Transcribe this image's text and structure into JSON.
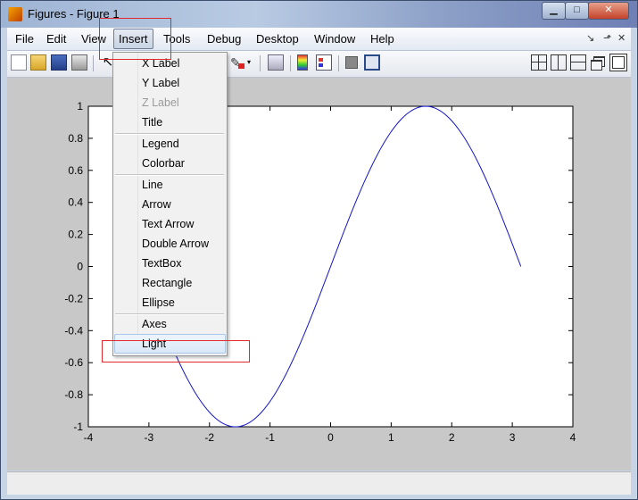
{
  "window": {
    "title": "Figures - Figure 1"
  },
  "window_controls": {
    "minimize": "▁",
    "maximize": "□",
    "close": "✕"
  },
  "menubar": {
    "items": [
      "File",
      "Edit",
      "View",
      "Insert",
      "Tools",
      "Debug",
      "Desktop",
      "Window",
      "Help"
    ],
    "active": "Insert",
    "dock_icons": [
      "↘",
      "⬏",
      "✕"
    ]
  },
  "toolbar": {
    "icons": [
      "new-figure-icon",
      "open-file-icon",
      "save-icon",
      "print-icon",
      "pointer-icon",
      "brush-icon",
      "link-plot-icon",
      "colorbar-icon",
      "legend-icon",
      "hide-plot-tools-icon",
      "show-plot-tools-icon"
    ],
    "layout_icons": [
      "tile-icon",
      "left-right-icon",
      "top-bottom-icon",
      "float-icon",
      "maximize-icon"
    ]
  },
  "insert_menu": {
    "items": [
      {
        "label": "X Label",
        "enabled": true
      },
      {
        "label": "Y Label",
        "enabled": true
      },
      {
        "label": "Z Label",
        "enabled": false
      },
      {
        "label": "Title",
        "enabled": true
      },
      {
        "separator": true
      },
      {
        "label": "Legend",
        "enabled": true
      },
      {
        "label": "Colorbar",
        "enabled": true
      },
      {
        "separator": true
      },
      {
        "label": "Line",
        "enabled": true
      },
      {
        "label": "Arrow",
        "enabled": true
      },
      {
        "label": "Text Arrow",
        "enabled": true
      },
      {
        "label": "Double Arrow",
        "enabled": true
      },
      {
        "label": "TextBox",
        "enabled": true
      },
      {
        "label": "Rectangle",
        "enabled": true
      },
      {
        "label": "Ellipse",
        "enabled": true
      },
      {
        "separator": true
      },
      {
        "label": "Axes",
        "enabled": true
      },
      {
        "label": "Light",
        "enabled": true,
        "highlighted": true
      }
    ]
  },
  "annotation_color": "#e0282e",
  "chart_data": {
    "type": "line",
    "function": "y = sin(x)",
    "x_range": [
      0,
      3.14159
    ],
    "xlim": [
      -4,
      4
    ],
    "ylim": [
      -1,
      1
    ],
    "xticks": [
      "-4",
      "-3",
      "-2",
      "-1",
      "0",
      "1",
      "2",
      "3",
      "4"
    ],
    "yticks": [
      "1",
      "0.8",
      "0.6",
      "0.4",
      "0.2",
      "0",
      "-0.2",
      "-0.4",
      "-0.6",
      "-0.8",
      "-1"
    ],
    "series": [
      {
        "color": "#1414c8",
        "x_start": -3.14159,
        "x_end": 3.14159,
        "samples": 160
      }
    ],
    "grid": false
  }
}
